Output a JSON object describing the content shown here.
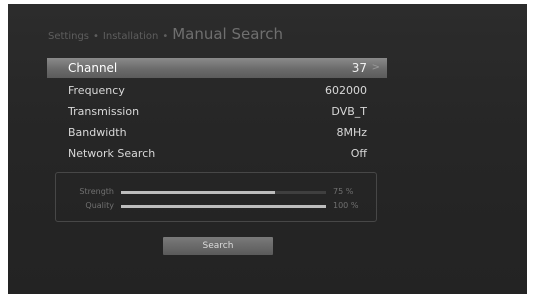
{
  "breadcrumb": {
    "level1": "Settings",
    "separator": "•",
    "level2": "Installation",
    "title": "Manual Search"
  },
  "menu": {
    "items": [
      {
        "label": "Channel",
        "value": "37"
      },
      {
        "label": "Frequency",
        "value": "602000"
      },
      {
        "label": "Transmission",
        "value": "DVB_T"
      },
      {
        "label": "Bandwidth",
        "value": "8MHz"
      },
      {
        "label": "Network Search",
        "value": "Off"
      }
    ],
    "selected_index": 0,
    "chevron_icon": "chevron-right-icon"
  },
  "signal": {
    "strength": {
      "label": "Strength",
      "value_text": "75 %",
      "level": 0.75
    },
    "quality": {
      "label": "Quality",
      "value_text": "100 %",
      "level": 1.0
    }
  },
  "search_button": {
    "label": "Search"
  },
  "colors": {
    "background": "#262626",
    "selected_bar": "#7a7a7a",
    "bar_fill": "#bdbdbd"
  }
}
